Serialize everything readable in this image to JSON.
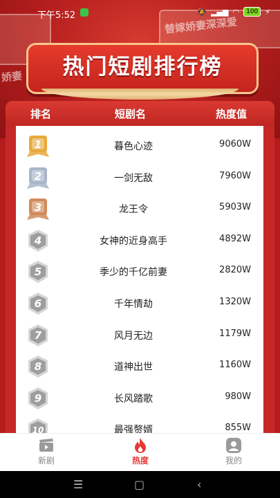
{
  "status": {
    "time": "下午5:52",
    "battery": "100"
  },
  "header": {
    "title": "热门短剧排行榜",
    "poster_texts": [
      "替嫁娇妻",
      "替嫁娇妻深深爱",
      "娇妻"
    ]
  },
  "table": {
    "col_rank": "排名",
    "col_title": "短剧名",
    "col_heat": "热度值",
    "rows": [
      {
        "rank": "1",
        "title": "暮色心迹",
        "heat": "9060W"
      },
      {
        "rank": "2",
        "title": "一剑无敌",
        "heat": "7960W"
      },
      {
        "rank": "3",
        "title": "龙王令",
        "heat": "5903W"
      },
      {
        "rank": "4",
        "title": "女神的近身高手",
        "heat": "4892W"
      },
      {
        "rank": "5",
        "title": "季少的千亿前妻",
        "heat": "2820W"
      },
      {
        "rank": "6",
        "title": "千年情劫",
        "heat": "1320W"
      },
      {
        "rank": "7",
        "title": "风月无边",
        "heat": "1179W"
      },
      {
        "rank": "8",
        "title": "道神出世",
        "heat": "1160W"
      },
      {
        "rank": "9",
        "title": "长风踏歌",
        "heat": "980W"
      },
      {
        "rank": "10",
        "title": "最强赘婿",
        "heat": "855W"
      }
    ]
  },
  "tabs": [
    {
      "label": "新剧",
      "icon": "clapperboard-icon"
    },
    {
      "label": "热度",
      "icon": "flame-icon",
      "active": true
    },
    {
      "label": "我的",
      "icon": "user-icon"
    }
  ],
  "colors": {
    "primary_red": "#c62828",
    "accent_red": "#e53935",
    "gold": "#e8a93c"
  }
}
